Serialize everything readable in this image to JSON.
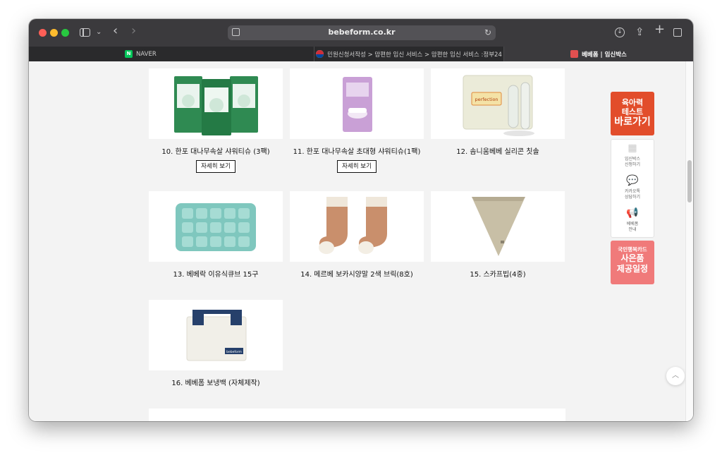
{
  "browser": {
    "address": "bebeform.co.kr",
    "tabs": [
      {
        "label": "NAVER"
      },
      {
        "label": "민원신청서작성 > 맘편한 임신 서비스 > 맘편한 임신 서비스 :정부24"
      },
      {
        "label": "베베폼 | 임신박스"
      }
    ],
    "favicon_naver": "N"
  },
  "products": [
    {
      "label": "10. 한포 대나무속살 샤워티슈 (3팩)",
      "detail": "자세히 보기"
    },
    {
      "label": "11. 한포 대나무속살 초대형 샤워티슈(1팩)",
      "detail": "자세히 보기"
    },
    {
      "label": "12. 솜니움베베 실리콘 칫솔"
    },
    {
      "label": "13. 베베락 이유식큐브 15구"
    },
    {
      "label": "14.  메르베 보카시양말 2색 브릭(8호)"
    },
    {
      "label": "15.  스카프빕(4중)"
    },
    {
      "label": "16. 베베폼 보냉백 (자체제작)"
    }
  ],
  "product_imagery": {
    "perfection_brand": "perfection",
    "bag_brand": "bebeform"
  },
  "side_widgets": {
    "test": {
      "line1": "육아력",
      "line2": "테스트",
      "line3": "바로가기"
    },
    "menu": [
      {
        "line1": "임신박스",
        "line2": "신청하기",
        "icon": "box-icon"
      },
      {
        "line1": "카카오톡",
        "line2": "상담하기",
        "icon": "chat-icon"
      },
      {
        "line1": "베베폼",
        "line2": "안내",
        "icon": "megaphone-icon"
      }
    ],
    "card": {
      "line1": "국민행복카드",
      "line2": "사은품",
      "line3": "제공일정"
    }
  },
  "colors": {
    "test_widget": "#e24d2b",
    "card_widget": "#f07a7a",
    "naver_green": "#03c75a"
  }
}
